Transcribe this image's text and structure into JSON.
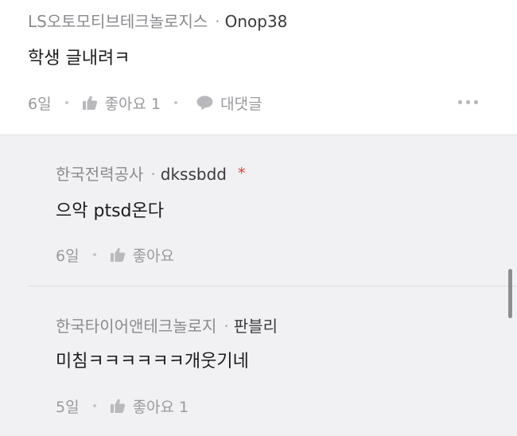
{
  "main_comment": {
    "company": "LS오토모티브테크놀로지스",
    "author": "Onop38",
    "text": "학생 글내려ㅋ",
    "time": "6일",
    "like_label": "좋아요 1",
    "reply_label": "대댓글",
    "separator": "·"
  },
  "replies": [
    {
      "company": "한국전력공사",
      "author": "dkssbdd",
      "badge": "*",
      "text": "으악 ptsd온다",
      "time": "6일",
      "like_label": "좋아요"
    },
    {
      "company": "한국타이어앤테크놀로지",
      "author": "판블리",
      "text": "미침ㅋㅋㅋㅋㅋㅋ개웃기네",
      "time": "5일",
      "like_label": "좋아요 1"
    }
  ],
  "colors": {
    "reply_background": "#f1f1f3",
    "accent_star": "#e03c3c",
    "muted_text": "#9a9a9e"
  },
  "icons": {
    "like": "thumbs-up-icon",
    "reply": "speech-bubble-icon",
    "more": "more-horizontal-icon"
  }
}
